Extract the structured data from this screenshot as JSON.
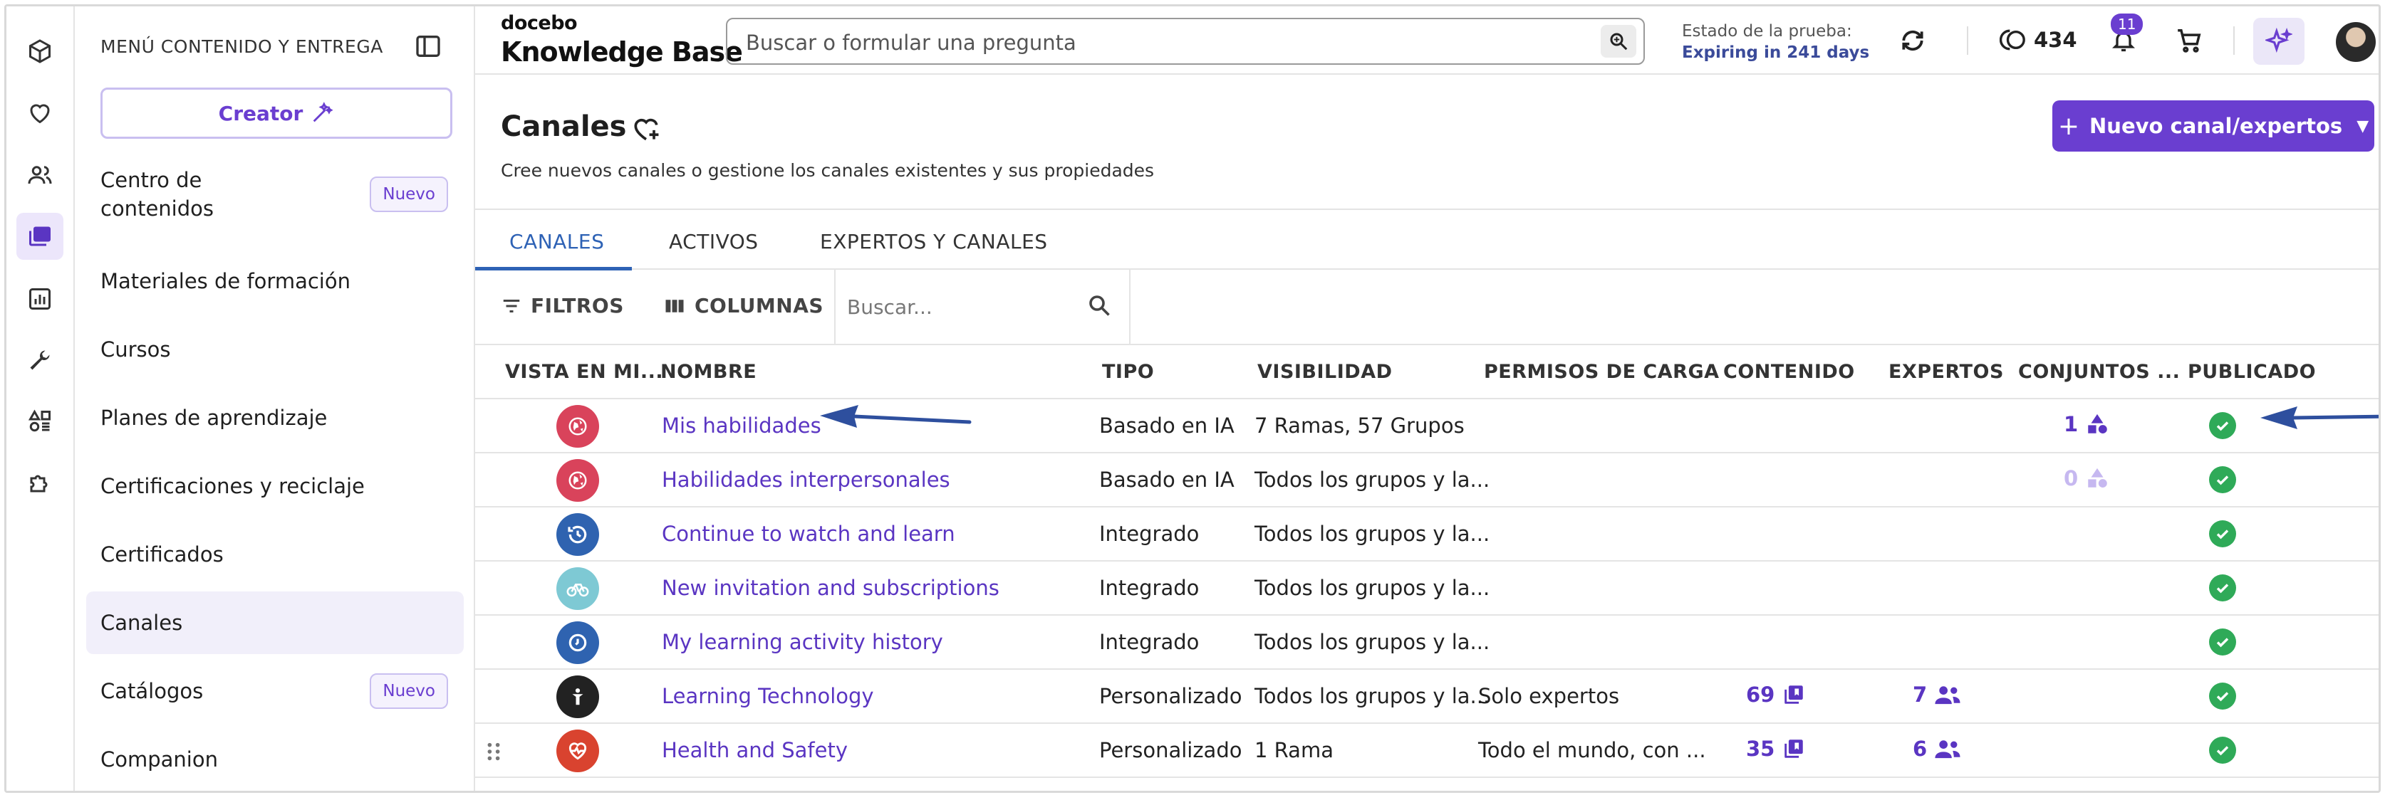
{
  "sidebar": {
    "title": "MENÚ CONTENIDO Y ENTREGA",
    "creator_label": "Creator",
    "items": [
      {
        "label": "Centro de contenidos",
        "badge": "Nuevo"
      },
      {
        "label": "Materiales de formación"
      },
      {
        "label": "Cursos"
      },
      {
        "label": "Planes de aprendizaje"
      },
      {
        "label": "Certificaciones y reciclaje"
      },
      {
        "label": "Certificados"
      },
      {
        "label": "Canales"
      },
      {
        "label": "Catálogos",
        "badge": "Nuevo"
      },
      {
        "label": "Companion"
      }
    ],
    "active_item": "Canales"
  },
  "topbar": {
    "brand_small": "docebo",
    "brand_big": "Knowledge Base",
    "search_placeholder": "Buscar o formular una pregunta",
    "trial_label": "Estado de la prueba:",
    "trial_value": "Expiring in 241 days",
    "credits": "434",
    "notifications": "11"
  },
  "page": {
    "title": "Canales",
    "subtitle": "Cree nuevos canales o gestione los canales existentes y sus propiedades",
    "new_button": "Nuevo canal/expertos"
  },
  "tabs": [
    "CANALES",
    "ACTIVOS",
    "EXPERTOS Y CANALES"
  ],
  "toolbar": {
    "filters": "FILTROS",
    "columns": "COLUMNAS",
    "search_placeholder": "Buscar..."
  },
  "table": {
    "headers": [
      "VISTA EN MI...",
      "NOMBRE",
      "TIPO",
      "VISIBILIDAD",
      "PERMISOS DE CARGA",
      "CONTENIDO",
      "EXPERTOS",
      "CONJUNTOS ...",
      "PUBLICADO"
    ],
    "rows": [
      {
        "icon": "globe-icon",
        "color": "#d9435b",
        "name": "Mis habilidades",
        "type": "Basado en IA",
        "visibility": "7 Ramas, 57 Grupos",
        "upload": "",
        "content": "",
        "experts": "",
        "sets": "1",
        "sets_faded": false
      },
      {
        "icon": "globe-icon",
        "color": "#d9435b",
        "name": "Habilidades interpersonales",
        "type": "Basado en IA",
        "visibility": "Todos los grupos y la...",
        "upload": "",
        "content": "",
        "experts": "",
        "sets": "0",
        "sets_faded": true
      },
      {
        "icon": "history-icon",
        "color": "#2f63b0",
        "name": "Continue to watch and learn",
        "type": "Integrado",
        "visibility": "Todos los grupos y la...",
        "upload": "",
        "content": "",
        "experts": "",
        "sets": ""
      },
      {
        "icon": "bike-icon",
        "color": "#7ec9d4",
        "name": "New invitation and subscriptions",
        "type": "Integrado",
        "visibility": "Todos los grupos y la...",
        "upload": "",
        "content": "",
        "experts": "",
        "sets": ""
      },
      {
        "icon": "clock-icon",
        "color": "#2f63b0",
        "name": "My learning activity history",
        "type": "Integrado",
        "visibility": "Todos los grupos y la...",
        "upload": "",
        "content": "",
        "experts": "",
        "sets": ""
      },
      {
        "icon": "person-icon",
        "color": "#222222",
        "name": "Learning Technology",
        "type": "Personalizado",
        "visibility": "Todos los grupos y la...",
        "upload": "Solo expertos",
        "content": "69",
        "experts": "7",
        "sets": ""
      },
      {
        "icon": "heart-pulse-icon",
        "color": "#d9432f",
        "name": "Health and Safety",
        "type": "Personalizado",
        "visibility": "1 Rama",
        "upload": "Todo el mundo, con ...",
        "content": "35",
        "experts": "6",
        "sets": ""
      }
    ]
  },
  "colors": {
    "accent": "#6a3ed0",
    "link": "#5a35c2",
    "tab_active": "#2e62b5",
    "published": "#2faa58",
    "arrow": "#2e4f9e"
  }
}
